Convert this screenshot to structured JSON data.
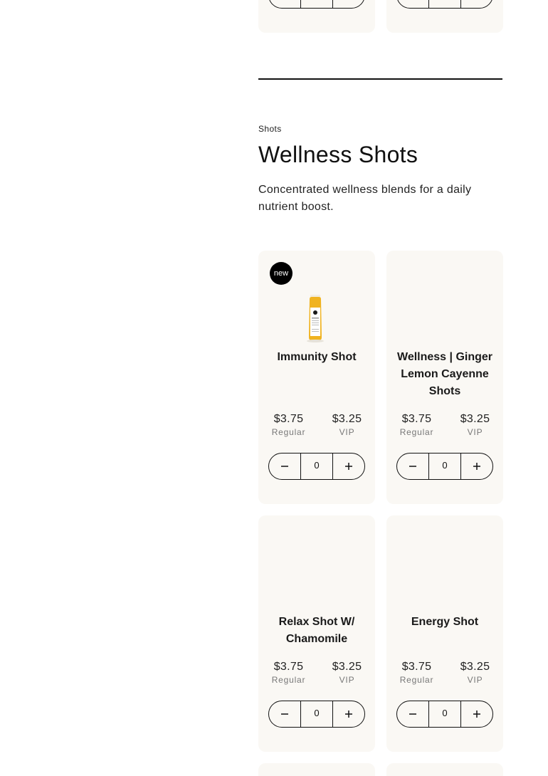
{
  "section": {
    "eyebrow": "Shots",
    "title": "Wellness Shots",
    "description": "Concentrated wellness blends for a daily nutrient boost."
  },
  "labels": {
    "regular": "Regular",
    "vip": "VIP",
    "minus_icon": "minus-icon",
    "plus_icon": "plus-icon"
  },
  "products": [
    {
      "name": "Immunity Shot",
      "badge": "new",
      "regular_price": "$3.75",
      "vip_price": "$3.25",
      "quantity": "0"
    },
    {
      "name": "Wellness | Ginger Lemon Cayenne Shots",
      "regular_price": "$3.75",
      "vip_price": "$3.25",
      "quantity": "0"
    },
    {
      "name": "Relax Shot W/ Chamomile",
      "regular_price": "$3.75",
      "vip_price": "$3.25",
      "quantity": "0"
    },
    {
      "name": "Energy Shot",
      "regular_price": "$3.75",
      "vip_price": "$3.25",
      "quantity": "0"
    }
  ]
}
